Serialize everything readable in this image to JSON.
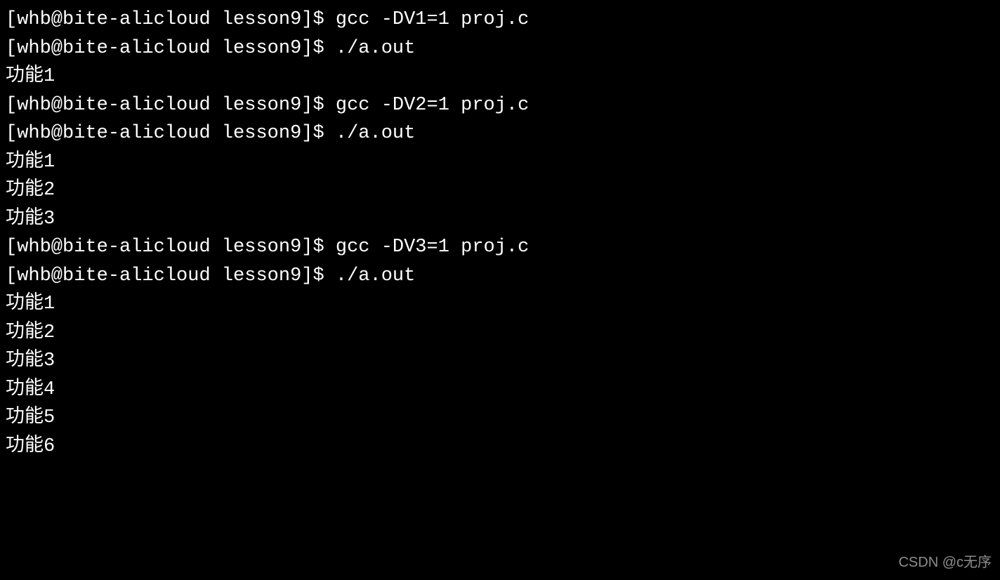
{
  "prompt": "[whb@bite-alicloud lesson9]$ ",
  "commands": {
    "gcc_v1": "gcc -DV1=1 proj.c",
    "gcc_v2": "gcc -DV2=1 proj.c",
    "gcc_v3": "gcc -DV3=1 proj.c",
    "run": "./a.out"
  },
  "outputs": {
    "f1": "功能1",
    "f2": "功能2",
    "f3": "功能3",
    "f4": "功能4",
    "f5": "功能5",
    "f6": "功能6"
  },
  "watermark": "CSDN @c无序"
}
